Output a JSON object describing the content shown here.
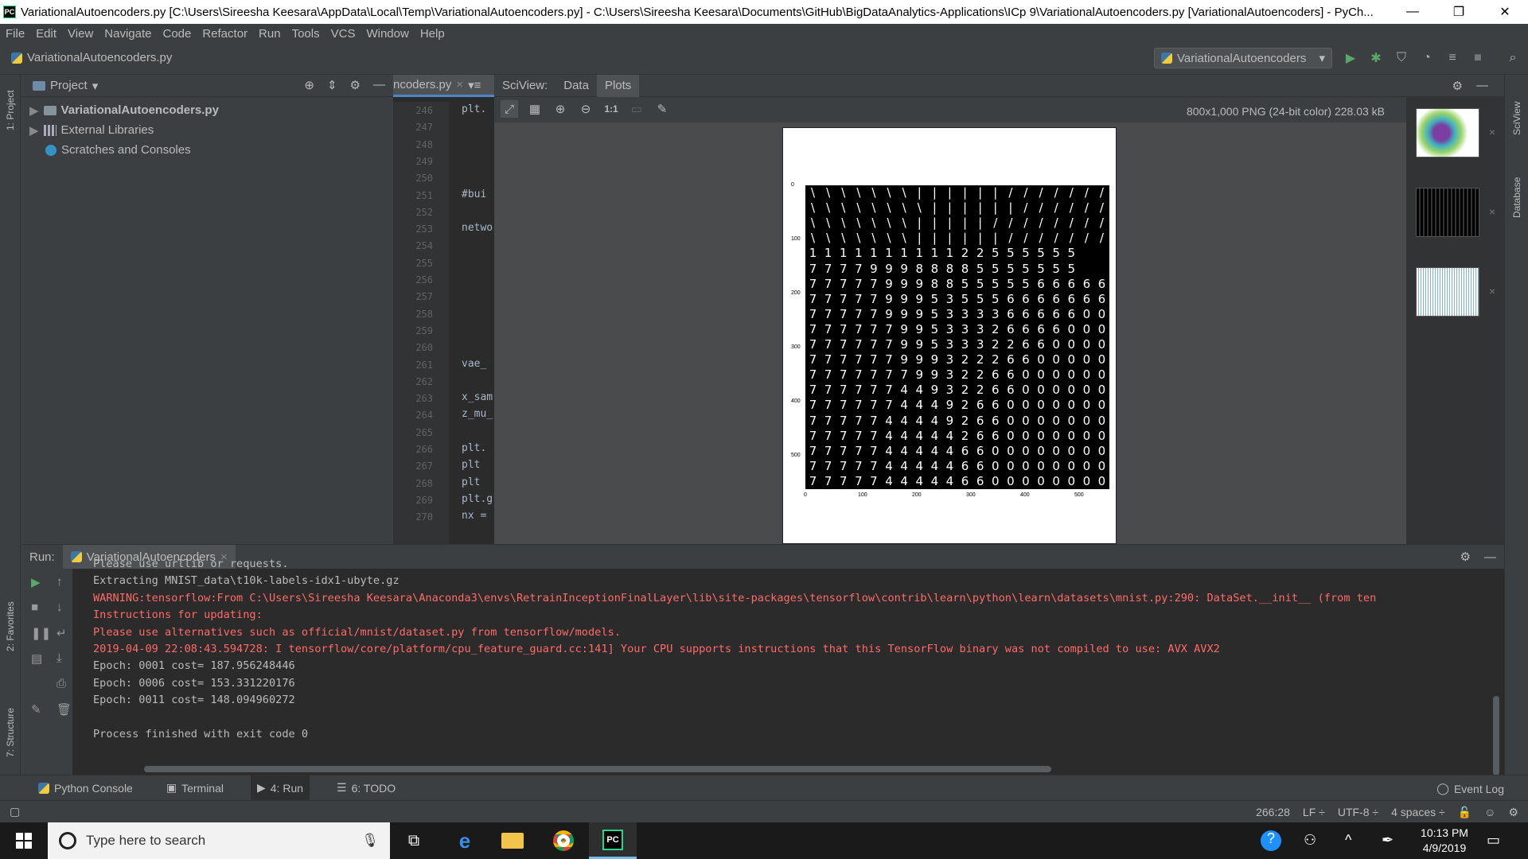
{
  "window": {
    "title": "VariationalAutoencoders.py [C:\\Users\\Sireesha Keesara\\AppData\\Local\\Temp\\VariationalAutoencoders.py] - C:\\Users\\Sireesha Keesara\\Documents\\GitHub\\BigDataAnalytics-Applications\\ICp 9\\VariationalAutoencoders.py [VariationalAutoencoders] - PyCh...",
    "app_icon": "PC",
    "minimize": "—",
    "restore": "❐",
    "close": "✕"
  },
  "menu": [
    "File",
    "Edit",
    "View",
    "Navigate",
    "Code",
    "Refactor",
    "Run",
    "Tools",
    "VCS",
    "Window",
    "Help"
  ],
  "navbar": {
    "breadcrumb": "VariationalAutoencoders.py",
    "run_config": "VariationalAutoencoders"
  },
  "left_stripe": {
    "project_tab": "1: Project",
    "favorites_tab": "2: Favorites",
    "structure_tab": "7: Structure"
  },
  "project_panel": {
    "title": "Project",
    "items": [
      {
        "label": "VariationalAutoencoders.py",
        "bold": true
      },
      {
        "label": "External Libraries",
        "bold": false
      },
      {
        "label": "Scratches and Consoles",
        "bold": false
      }
    ]
  },
  "editor": {
    "tab_label": "ncoders.py",
    "line_numbers": [
      "246",
      "247",
      "248",
      "249",
      "250",
      "251",
      "252",
      "253",
      "254",
      "255",
      "256",
      "257",
      "258",
      "259",
      "260",
      "261",
      "262",
      "263",
      "264",
      "265",
      "266",
      "267",
      "268",
      "269",
      "270"
    ],
    "code_fragments": {
      "246": "plt.",
      "251": "#bui",
      "253": "netwo",
      "261": "vae_",
      "263": "x_sam",
      "264": "z_mu_",
      "266": "plt.",
      "267": "plt",
      "268": "plt",
      "269": "plt.g",
      "270": "nx ="
    }
  },
  "sciview": {
    "title": "SciView:",
    "tabs": [
      "Data",
      "Plots"
    ],
    "image_info": "800x1,000 PNG (24-bit color) 228.03 kB",
    "zoom_1to1": "1:1",
    "y_ticks": [
      "0",
      "100",
      "200",
      "300",
      "400",
      "500"
    ],
    "x_ticks": [
      "0",
      "100",
      "200",
      "300",
      "400",
      "500"
    ],
    "digit_rows": [
      "\\\\\\\\\\\\\\||||||//////////",
      "\\\\\\\\\\\\\\\\||||||/////////",
      "\\\\\\\\\\\\\\|||||///////////",
      "\\\\\\\\\\\\\\||||||/////////",
      "1111111111 2 2 5 5 5 5 5 5",
      "7777999888 8 5 5 5 5 5 5 5",
      "77777999885555566666",
      "77777999535556666666",
      "77777999533336666600",
      "77777799533326666000",
      "77777799533322660000",
      "77777799932226600000",
      "77777779932266000000",
      "77777744932266000000",
      "77777744492660000000",
      "77777444492660000000",
      "77777444442660000000",
      "77777444446600000000",
      "77777444446600000000",
      "77777444446600000000"
    ]
  },
  "run_panel": {
    "label": "Run:",
    "tab": "VariationalAutoencoders",
    "lines": [
      {
        "text": "Please use urllib or requests.",
        "color": "norm"
      },
      {
        "text": "Extracting MNIST_data\\t10k-labels-idx1-ubyte.gz",
        "color": "norm"
      },
      {
        "text": "WARNING:tensorflow:From C:\\Users\\Sireesha Keesara\\Anaconda3\\envs\\RetrainInceptionFinalLayer\\lib\\site-packages\\tensorflow\\contrib\\learn\\python\\learn\\datasets\\mnist.py:290: DataSet.__init__ (from ten",
        "color": "red"
      },
      {
        "text": "Instructions for updating:",
        "color": "red"
      },
      {
        "text": "Please use alternatives such as official/mnist/dataset.py from tensorflow/models.",
        "color": "red"
      },
      {
        "text": "2019-04-09 22:08:43.594728: I tensorflow/core/platform/cpu_feature_guard.cc:141] Your CPU supports instructions that this TensorFlow binary was not compiled to use: AVX AVX2",
        "color": "red"
      },
      {
        "text": "Epoch: 0001 cost= 187.956248446",
        "color": "norm"
      },
      {
        "text": "Epoch: 0006 cost= 153.331220176",
        "color": "norm"
      },
      {
        "text": "Epoch: 0011 cost= 148.094960272",
        "color": "norm"
      },
      {
        "text": "",
        "color": "norm"
      },
      {
        "text": "Process finished with exit code 0",
        "color": "norm"
      }
    ]
  },
  "tool_tabs": {
    "python_console": "Python Console",
    "terminal": "Terminal",
    "run": "4: Run",
    "todo": "6: TODO",
    "event_log": "Event Log"
  },
  "status": {
    "position": "266:28",
    "line_sep": "LF ÷",
    "encoding": "UTF-8 ÷",
    "indent": "4 spaces ÷"
  },
  "right_stripe": {
    "sciview": "SciView",
    "database": "Database"
  },
  "taskbar": {
    "search_placeholder": "Type here to search",
    "time": "10:13 PM",
    "date": "4/9/2019"
  }
}
